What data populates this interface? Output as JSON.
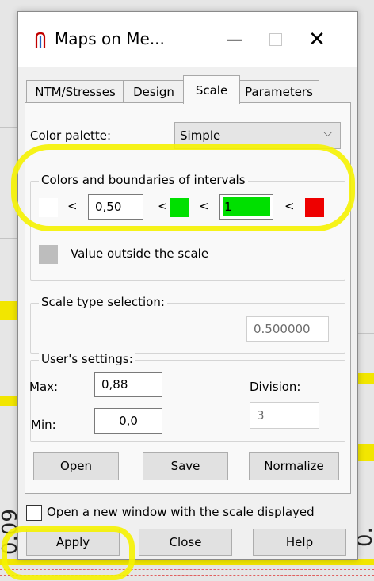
{
  "window": {
    "title": "Maps on Me...",
    "minimize_glyph": "—",
    "close_glyph": "✕"
  },
  "tabs": [
    {
      "label": "NTM/Stresses"
    },
    {
      "label": "Design"
    },
    {
      "label": "Scale",
      "active": true
    },
    {
      "label": "Parameters"
    }
  ],
  "palette": {
    "label": "Color palette:",
    "value": "Simple",
    "chevron": "⌵"
  },
  "intervals": {
    "title": "Colors and boundaries of intervals",
    "lt": "<",
    "lower_bound": "0,50",
    "upper_bound": "1",
    "colors": {
      "low": "#ffffff",
      "mid": "#00e000",
      "high": "#ee0000"
    },
    "outside_label": "Value outside the scale",
    "outside_color": "#bdbdbd"
  },
  "scale_type": {
    "title": "Scale type selection:",
    "value": "0.500000"
  },
  "user_settings": {
    "title": "User's settings:",
    "max_label": "Max:",
    "max_value": "0,88",
    "min_label": "Min:",
    "min_value": "0,0",
    "division_label": "Division:",
    "division_value": "3"
  },
  "actions": {
    "open": "Open",
    "save": "Save",
    "normalize": "Normalize"
  },
  "open_new_window": {
    "label": "Open a new window with the scale displayed",
    "checked": false
  },
  "footer": {
    "apply": "Apply",
    "close": "Close",
    "help": "Help"
  },
  "background": {
    "left_number": "0.09",
    "right_number": "0."
  },
  "colors": {
    "highlight": "#f5f200",
    "accent": "#0078d7"
  }
}
